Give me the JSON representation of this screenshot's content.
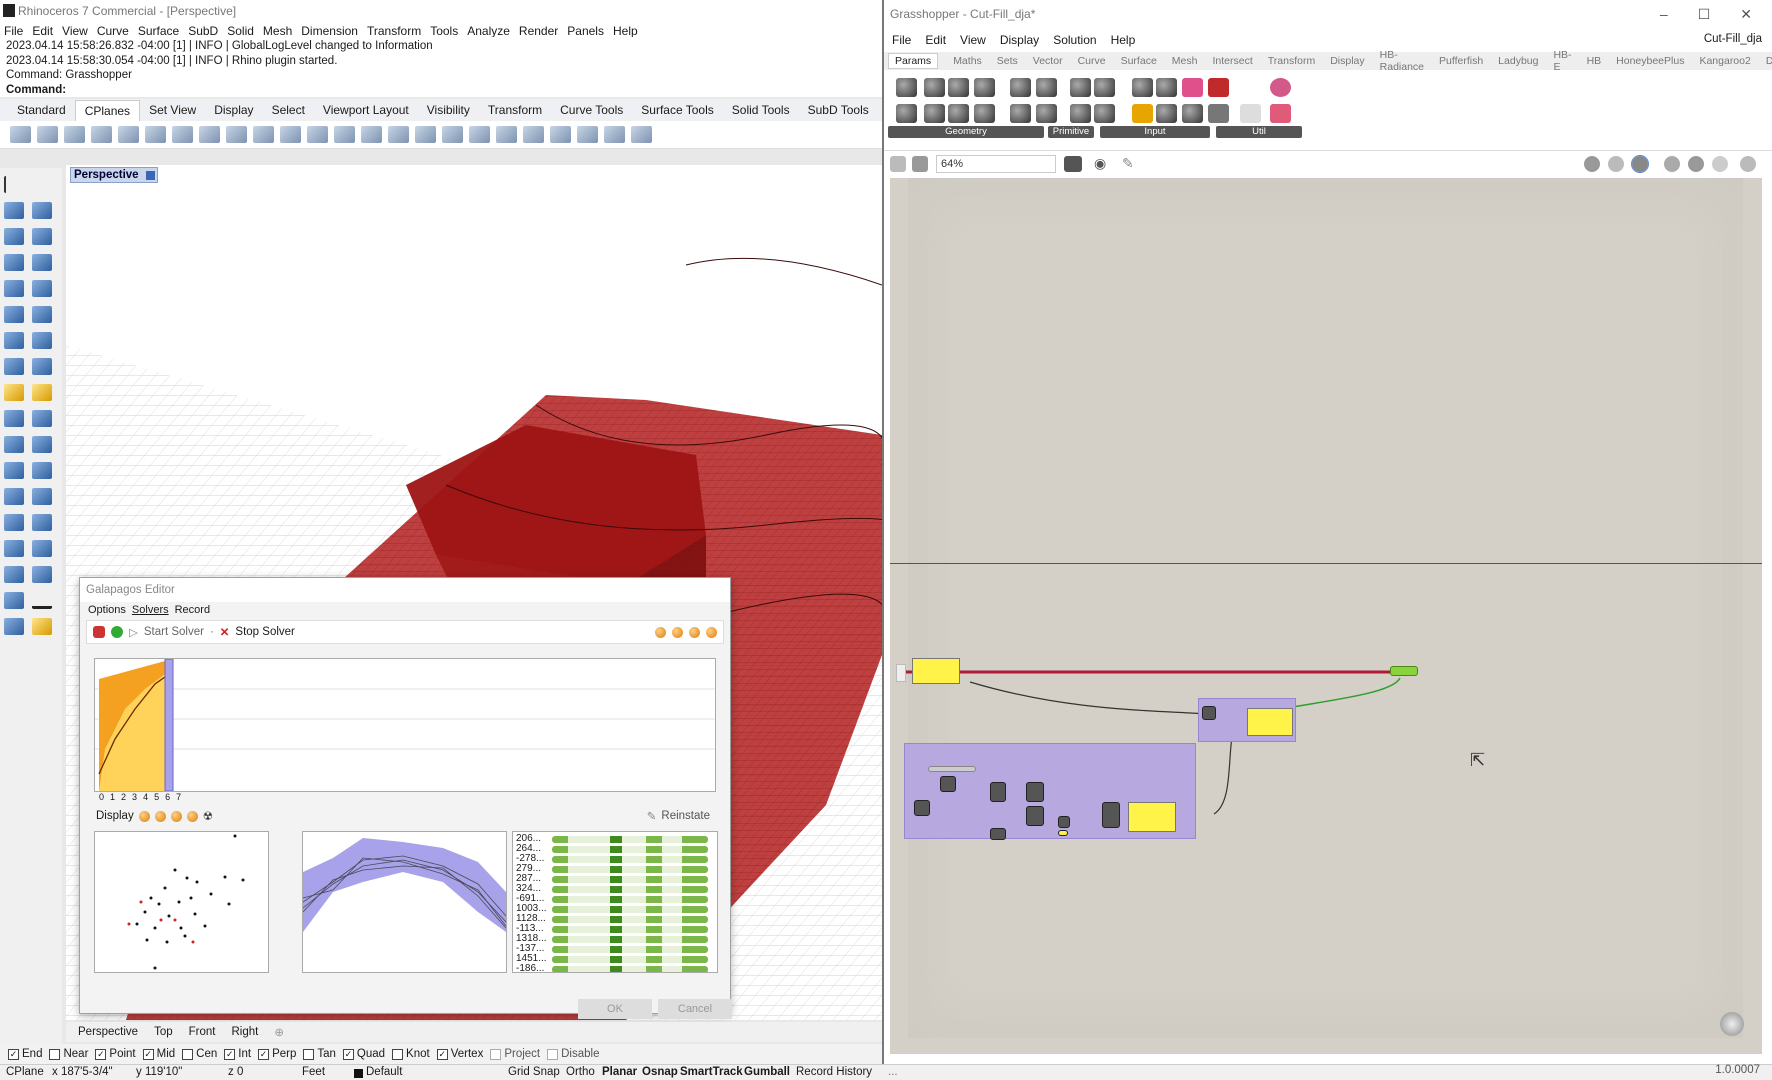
{
  "rhino": {
    "title": "Rhinoceros 7 Commercial - [Perspective]",
    "menu": [
      "File",
      "Edit",
      "View",
      "Curve",
      "Surface",
      "SubD",
      "Solid",
      "Mesh",
      "Dimension",
      "Transform",
      "Tools",
      "Analyze",
      "Render",
      "Panels",
      "Help"
    ],
    "command_history": [
      "2023.04.14 15:58:26.832 -04:00 [1] | INFO | GlobalLogLevel changed to Information",
      "2023.04.14 15:58:30.054 -04:00 [1] | INFO | Rhino plugin started.",
      "Command: Grasshopper"
    ],
    "command_prompt": "Command:",
    "toolbar_tabs": [
      "Standard",
      "CPlanes",
      "Set View",
      "Display",
      "Select",
      "Viewport Layout",
      "Visibility",
      "Transform",
      "Curve Tools",
      "Surface Tools",
      "Solid Tools",
      "SubD Tools"
    ],
    "viewport_label": "Perspective",
    "viewport_tabs": [
      "Perspective",
      "Top",
      "Front",
      "Right"
    ],
    "osnaps": [
      {
        "label": "End",
        "checked": true
      },
      {
        "label": "Near",
        "checked": false
      },
      {
        "label": "Point",
        "checked": true
      },
      {
        "label": "Mid",
        "checked": true
      },
      {
        "label": "Cen",
        "checked": false
      },
      {
        "label": "Int",
        "checked": true
      },
      {
        "label": "Perp",
        "checked": true
      },
      {
        "label": "Tan",
        "checked": false
      },
      {
        "label": "Quad",
        "checked": true
      },
      {
        "label": "Knot",
        "checked": false
      },
      {
        "label": "Vertex",
        "checked": true
      },
      {
        "label": "Project",
        "checked": false
      },
      {
        "label": "Disable",
        "checked": false
      }
    ],
    "status": {
      "cplane": "CPlane",
      "x": "x 187'5-3/4\"",
      "y": "y 119'10\"",
      "z": "z 0",
      "units": "Feet",
      "layer": "Default",
      "toggles": [
        "Grid Snap",
        "Ortho",
        "Planar",
        "Osnap",
        "SmartTrack",
        "Gumball",
        "Record History"
      ]
    },
    "model_color": "#b31e1e"
  },
  "galapagos": {
    "title": "Galapagos Editor",
    "tabs": [
      "Options",
      "Solvers",
      "Record"
    ],
    "start_solver": "Start Solver",
    "stop_solver": "Stop Solver",
    "chart_axis": [
      "0",
      "1",
      "2",
      "3",
      "4",
      "5",
      "6",
      "7"
    ],
    "display_label": "Display",
    "reinstate": "Reinstate",
    "genomes": [
      "206...",
      "264...",
      "-278...",
      "279...",
      "287...",
      "324...",
      "-691...",
      "1003...",
      "1128...",
      "-113...",
      "1318...",
      "-137...",
      "1451...",
      "-186..."
    ],
    "ok": "OK",
    "cancel": "Cancel"
  },
  "grasshopper": {
    "title": "Grasshopper - Cut-Fill_dja*",
    "doc_name": "Cut-Fill_dja",
    "menu": [
      "File",
      "Edit",
      "View",
      "Display",
      "Solution",
      "Help"
    ],
    "tabs": [
      "Params",
      "Maths",
      "Sets",
      "Vector",
      "Curve",
      "Surface",
      "Mesh",
      "Intersect",
      "Transform",
      "Display",
      "HB-Radiance",
      "Pufferfish",
      "Ladybug",
      "HB-E",
      "HB",
      "HoneybeePlus",
      "Kangaroo2",
      "DF"
    ],
    "palette_sections": [
      "Geometry",
      "Primitive",
      "Input",
      "Util"
    ],
    "zoom": "64%",
    "version": "1.0.0007"
  }
}
